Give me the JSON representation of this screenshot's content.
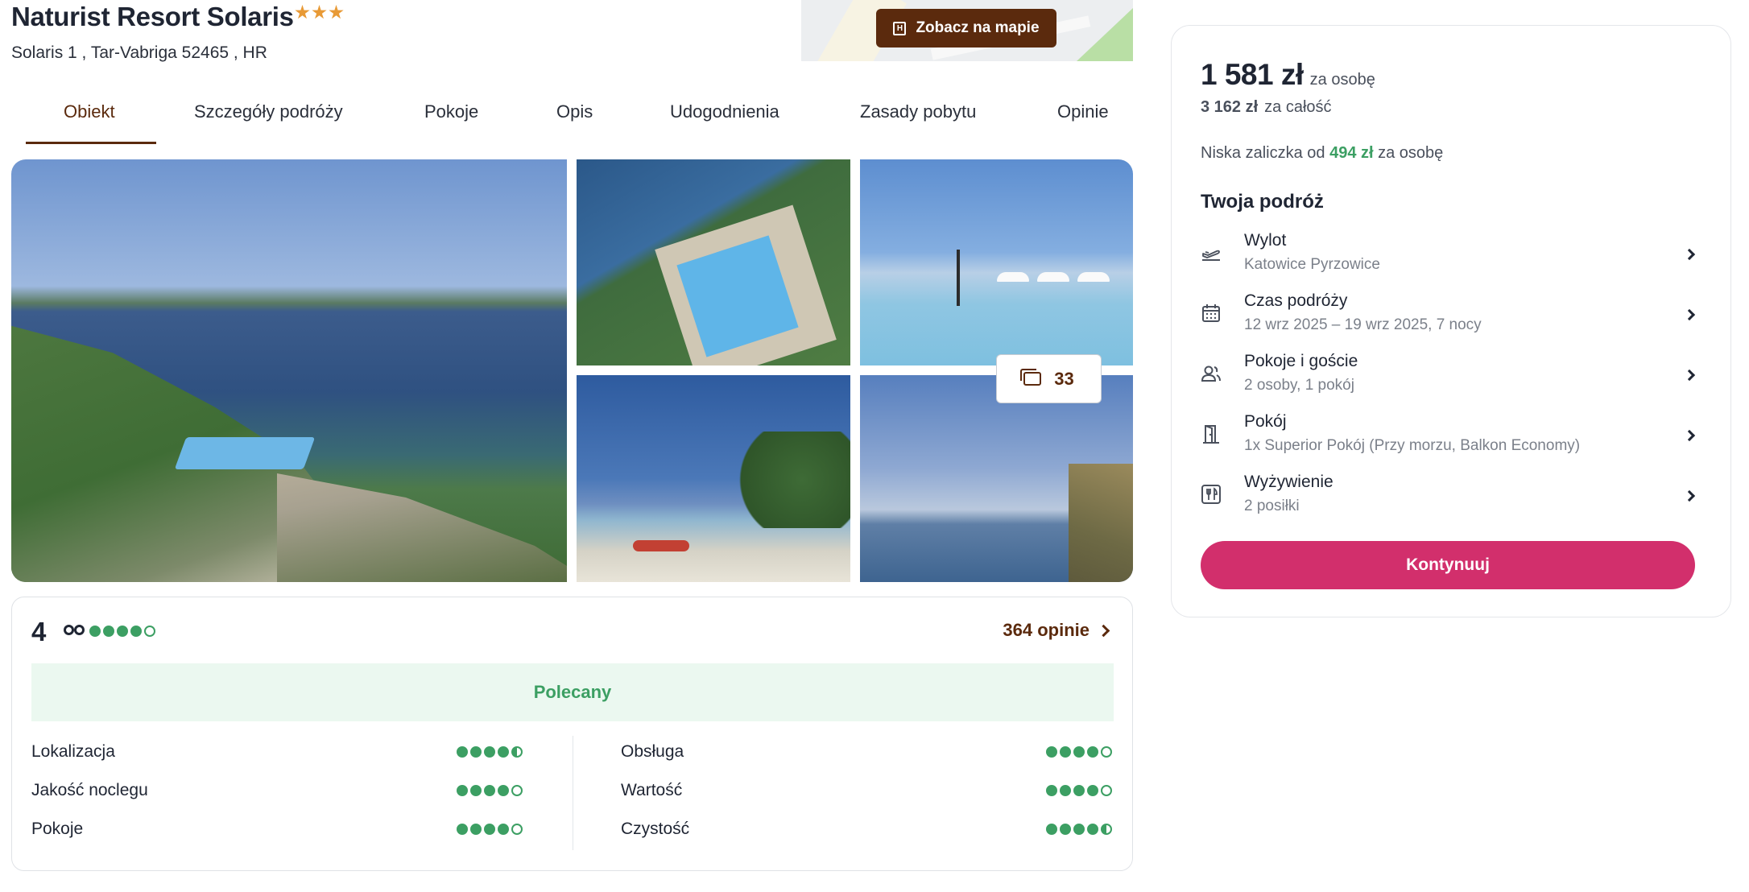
{
  "hotel": {
    "name": "Naturist Resort Solaris",
    "stars": 3,
    "address": "Solaris 1 , Tar-Vabriga 52465 , HR",
    "map_button_label": "Zobacz na mapie"
  },
  "tabs": [
    {
      "label": "Obiekt",
      "active": true
    },
    {
      "label": "Szczegóły podróży",
      "active": false
    },
    {
      "label": "Pokoje",
      "active": false
    },
    {
      "label": "Opis",
      "active": false
    },
    {
      "label": "Udogodnienia",
      "active": false
    },
    {
      "label": "Zasady pobytu",
      "active": false
    },
    {
      "label": "Opinie",
      "active": false
    }
  ],
  "gallery": {
    "photo_count": "33",
    "count_icon": "gallery-icon"
  },
  "ratings": {
    "overall": "4",
    "overall_bubbles": 4,
    "provider_icon": "tripadvisor-icon",
    "reviews_link": "364 opinie",
    "verdict": "Polecany",
    "categories": [
      {
        "label": "Lokalizacja",
        "score": 4.5
      },
      {
        "label": "Jakość noclegu",
        "score": 4
      },
      {
        "label": "Pokoje",
        "score": 4
      },
      {
        "label": "Obsługa",
        "score": 4
      },
      {
        "label": "Wartość",
        "score": 4
      },
      {
        "label": "Czystość",
        "score": 4.5
      }
    ],
    "accent_color": "#3c9f63"
  },
  "booking": {
    "price": "1 581 zł",
    "price_per": "za osobę",
    "total_price": "3 162 zł",
    "total_label": "za całość",
    "deposit_prefix": "Niska zaliczka od",
    "deposit_amount": "494 zł",
    "deposit_suffix": "za osobę",
    "trip_heading": "Twoja podróż",
    "trip_items": [
      {
        "icon": "plane-departure-icon",
        "label": "Wylot",
        "value": "Katowice Pyrzowice"
      },
      {
        "icon": "calendar-icon",
        "label": "Czas podróży",
        "value": "12 wrz 2025 – 19 wrz 2025, 7 nocy"
      },
      {
        "icon": "users-icon",
        "label": "Pokoje i goście",
        "value": "2 osoby, 1 pokój"
      },
      {
        "icon": "door-icon",
        "label": "Pokój",
        "value": "1x Superior Pokój (Przy morzu, Balkon Economy)"
      },
      {
        "icon": "fork-knife-icon",
        "label": "Wyżywienie",
        "value": "2 posiłki"
      }
    ],
    "continue_label": "Kontynuuj",
    "continue_color": "#d22f6c"
  }
}
